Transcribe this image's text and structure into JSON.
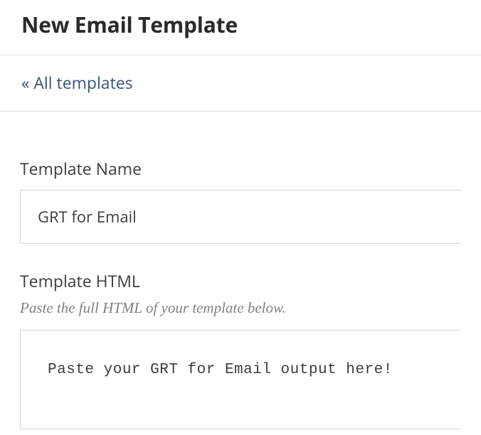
{
  "header": {
    "title": "New Email Template"
  },
  "breadcrumb": {
    "back_label": "« All templates"
  },
  "form": {
    "template_name": {
      "label": "Template Name",
      "value": "GRT for Email"
    },
    "template_html": {
      "label": "Template HTML",
      "helper": "Paste the full HTML of your template below.",
      "value": "Paste your GRT for Email output here!"
    }
  }
}
